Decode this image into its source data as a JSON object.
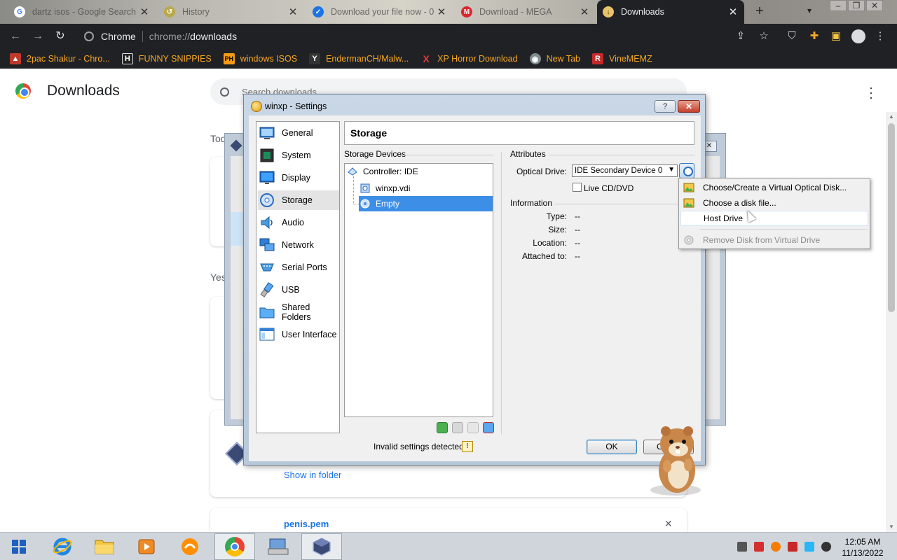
{
  "tabs": [
    {
      "title": "dartz isos - Google Search",
      "icon": "google-icon"
    },
    {
      "title": "History",
      "icon": "history-icon"
    },
    {
      "title": "Download your file now - 0",
      "icon": "check-icon"
    },
    {
      "title": "Download - MEGA",
      "icon": "mega-icon"
    },
    {
      "title": "Downloads",
      "icon": "download-icon"
    }
  ],
  "toolbar": {
    "site": "Chrome",
    "url_scheme": "chrome://",
    "url_path": "downloads"
  },
  "bookmarks": [
    {
      "label": "2pac Shakur - Chro...",
      "glyph": "▲",
      "color": "#c0392b"
    },
    {
      "label": "FUNNY SNIPPIES",
      "glyph": "H",
      "color": "#222222"
    },
    {
      "label": "windows ISOS",
      "glyph": "PH",
      "color": "#f39c12"
    },
    {
      "label": "EndermanCH/Malw...",
      "glyph": "Y",
      "color": "#222222"
    },
    {
      "label": "XP Horror Download",
      "glyph": "X",
      "color": "#e53935"
    },
    {
      "label": "New Tab",
      "glyph": "◉",
      "color": "#7f8c8d"
    },
    {
      "label": "VineMEMZ",
      "glyph": "R",
      "color": "#c62828"
    }
  ],
  "downloads": {
    "title": "Downloads",
    "search_placeholder": "Search downloads",
    "today_label": "Tod",
    "yesterday_label": "Yes",
    "show_in_folder": "Show in folder",
    "file_name": "penis.pem",
    "close": "✕"
  },
  "dialog": {
    "title": "winxp - Settings",
    "help": "?",
    "close": "✕",
    "categories": [
      {
        "label": "General",
        "icon": "general-icon"
      },
      {
        "label": "System",
        "icon": "system-icon"
      },
      {
        "label": "Display",
        "icon": "display-icon"
      },
      {
        "label": "Storage",
        "icon": "storage-icon"
      },
      {
        "label": "Audio",
        "icon": "audio-icon"
      },
      {
        "label": "Network",
        "icon": "network-icon"
      },
      {
        "label": "Serial Ports",
        "icon": "serial-ports-icon"
      },
      {
        "label": "USB",
        "icon": "usb-icon"
      },
      {
        "label": "Shared Folders",
        "icon": "shared-folders-icon"
      },
      {
        "label": "User Interface",
        "icon": "user-interface-icon"
      }
    ],
    "selected_category": "Storage",
    "pane_title": "Storage",
    "storage_devices_label": "Storage Devices",
    "tree": {
      "controller": "Controller: IDE",
      "disk": "winxp.vdi",
      "optical": "Empty"
    },
    "attributes_label": "Attributes",
    "optical_drive_label": "Optical Drive:",
    "optical_drive_value": "IDE Secondary Device 0",
    "live_cd_label": "Live CD/DVD",
    "information_label": "Information",
    "info": [
      {
        "label": "Type:",
        "value": "--"
      },
      {
        "label": "Size:",
        "value": "--"
      },
      {
        "label": "Location:",
        "value": "--"
      },
      {
        "label": "Attached to:",
        "value": "--"
      }
    ],
    "invalid_settings": "Invalid settings detected",
    "ok": "OK",
    "cancel": "Ca"
  },
  "context_menu": {
    "items": [
      {
        "label": "Choose/Create a Virtual Optical Disk...",
        "enabled": true
      },
      {
        "label": "Choose a disk file...",
        "enabled": true
      },
      {
        "label": "Host Drive",
        "enabled": true
      },
      {
        "label": "Remove Disk from Virtual Drive",
        "enabled": false
      }
    ]
  },
  "taskbar": {
    "time": "12:05 AM",
    "date": "11/13/2022"
  },
  "colors": {
    "chrome_dark": "#202124",
    "bookmark_text": "#f5a623",
    "link_blue": "#1a73e8",
    "selection_blue": "#3d8ee6"
  }
}
